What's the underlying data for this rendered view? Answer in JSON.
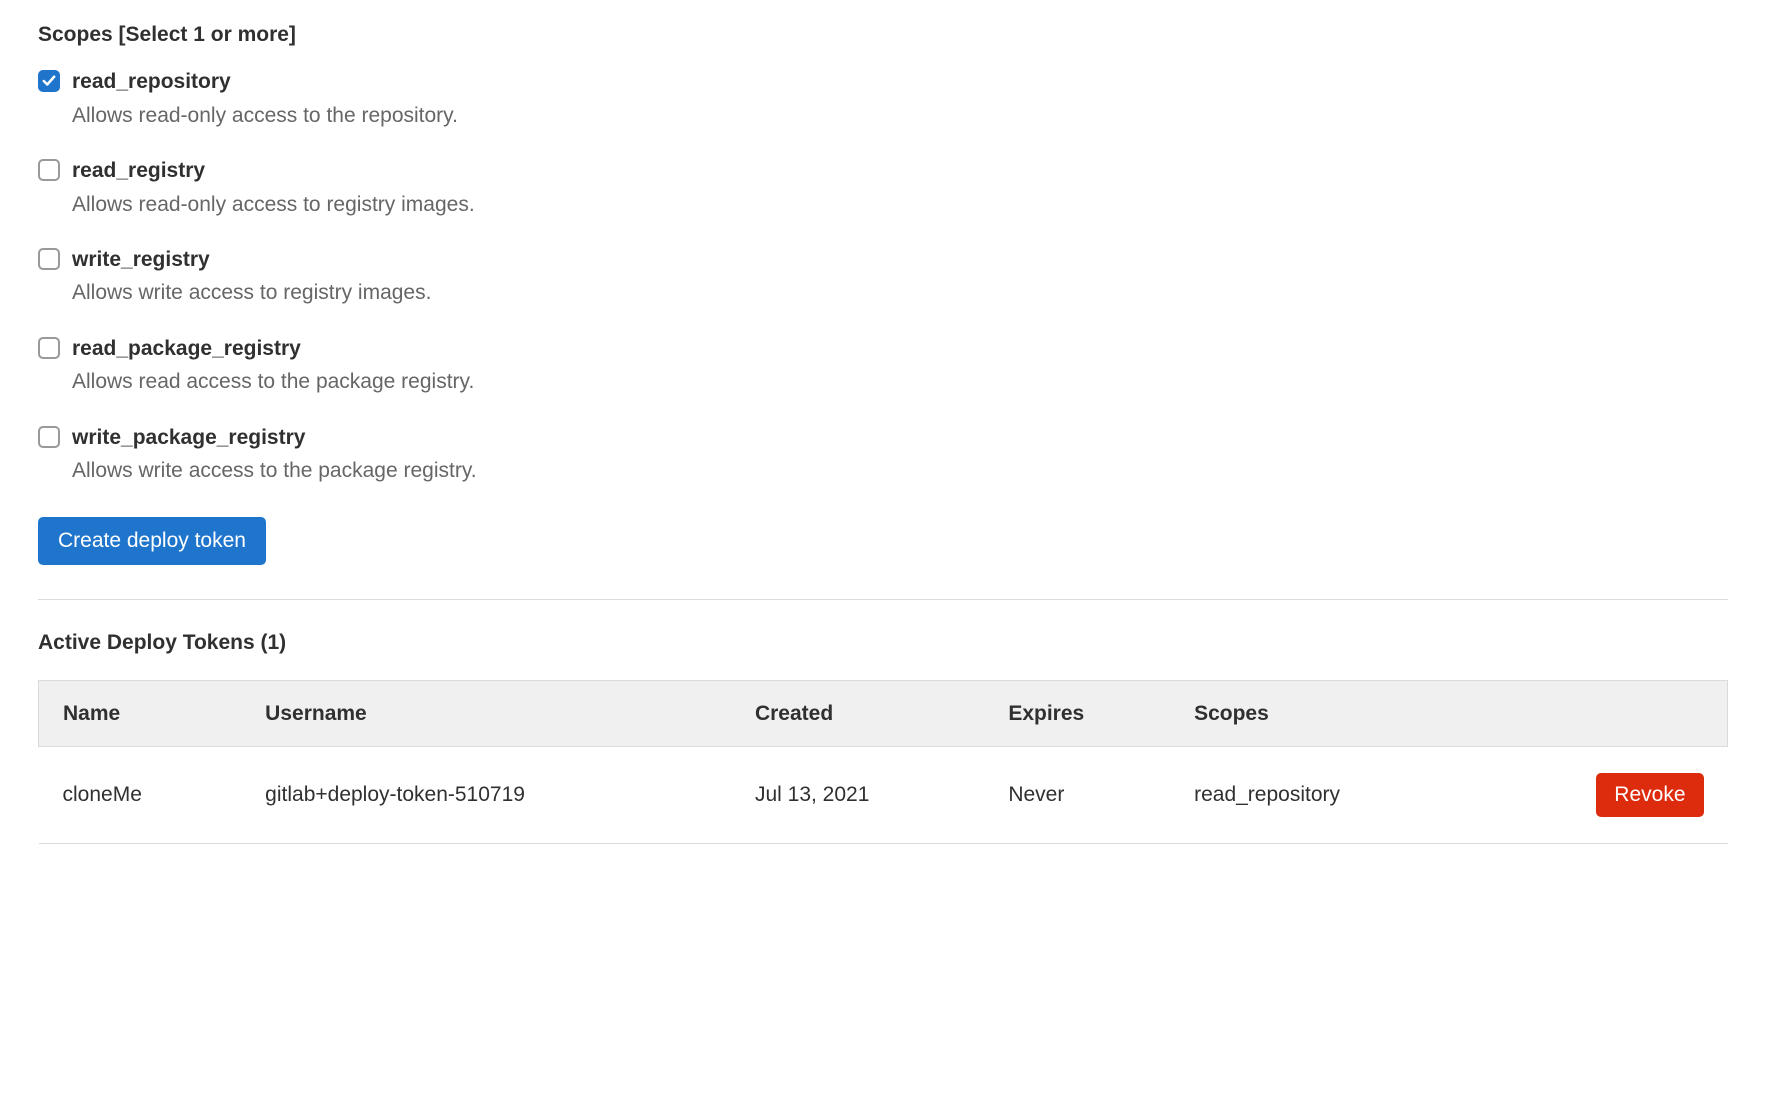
{
  "scopes_label": "Scopes [Select 1 or more]",
  "scopes": [
    {
      "name": "read_repository",
      "desc": "Allows read-only access to the repository.",
      "checked": true
    },
    {
      "name": "read_registry",
      "desc": "Allows read-only access to registry images.",
      "checked": false
    },
    {
      "name": "write_registry",
      "desc": "Allows write access to registry images.",
      "checked": false
    },
    {
      "name": "read_package_registry",
      "desc": "Allows read access to the package registry.",
      "checked": false
    },
    {
      "name": "write_package_registry",
      "desc": "Allows write access to the package registry.",
      "checked": false
    }
  ],
  "create_button": "Create deploy token",
  "active_heading": "Active Deploy Tokens (1)",
  "table": {
    "headers": {
      "name": "Name",
      "username": "Username",
      "created": "Created",
      "expires": "Expires",
      "scopes": "Scopes",
      "actions": ""
    },
    "rows": [
      {
        "name": "cloneMe",
        "username": "gitlab+deploy-token-510719",
        "created": "Jul 13, 2021",
        "expires": "Never",
        "scopes": "read_repository",
        "revoke": "Revoke"
      }
    ]
  }
}
